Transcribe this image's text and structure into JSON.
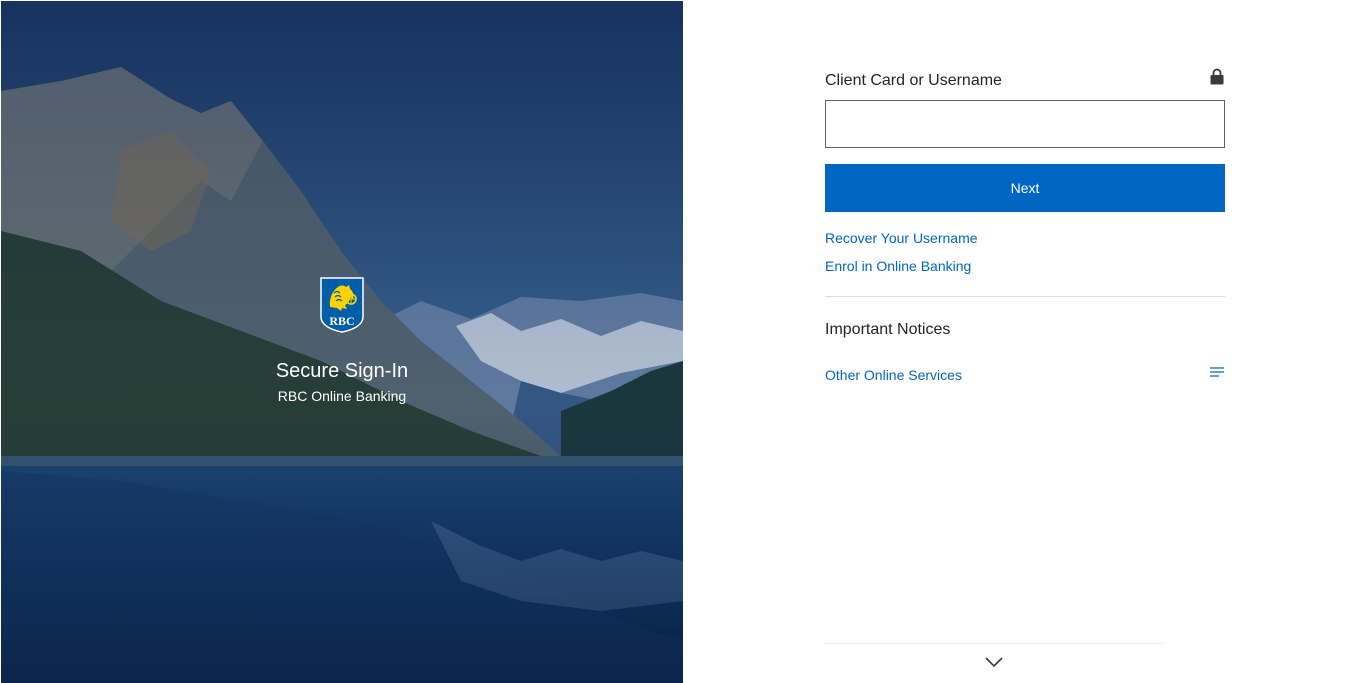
{
  "hero": {
    "title": "Secure Sign-In",
    "subtitle": "RBC Online Banking",
    "logo_text": "RBC",
    "logo_icon": "rbc-lion-shield-logo"
  },
  "form": {
    "username_label": "Client Card or Username",
    "username_value": "",
    "lock_icon": "lock-icon",
    "next_label": "Next"
  },
  "links": {
    "recover_username": "Recover Your Username",
    "enrol": "Enrol in Online Banking"
  },
  "notices": {
    "title": "Important Notices",
    "other_services": "Other Online Services",
    "menu_icon": "menu-lines-icon",
    "expand_icon": "chevron-down-icon"
  },
  "colors": {
    "primary_blue": "#0066c4",
    "text_dark": "#252525",
    "logo_blue": "#005daa",
    "logo_gold": "#ffd200",
    "hero_overlay": "#0a2a5a"
  }
}
